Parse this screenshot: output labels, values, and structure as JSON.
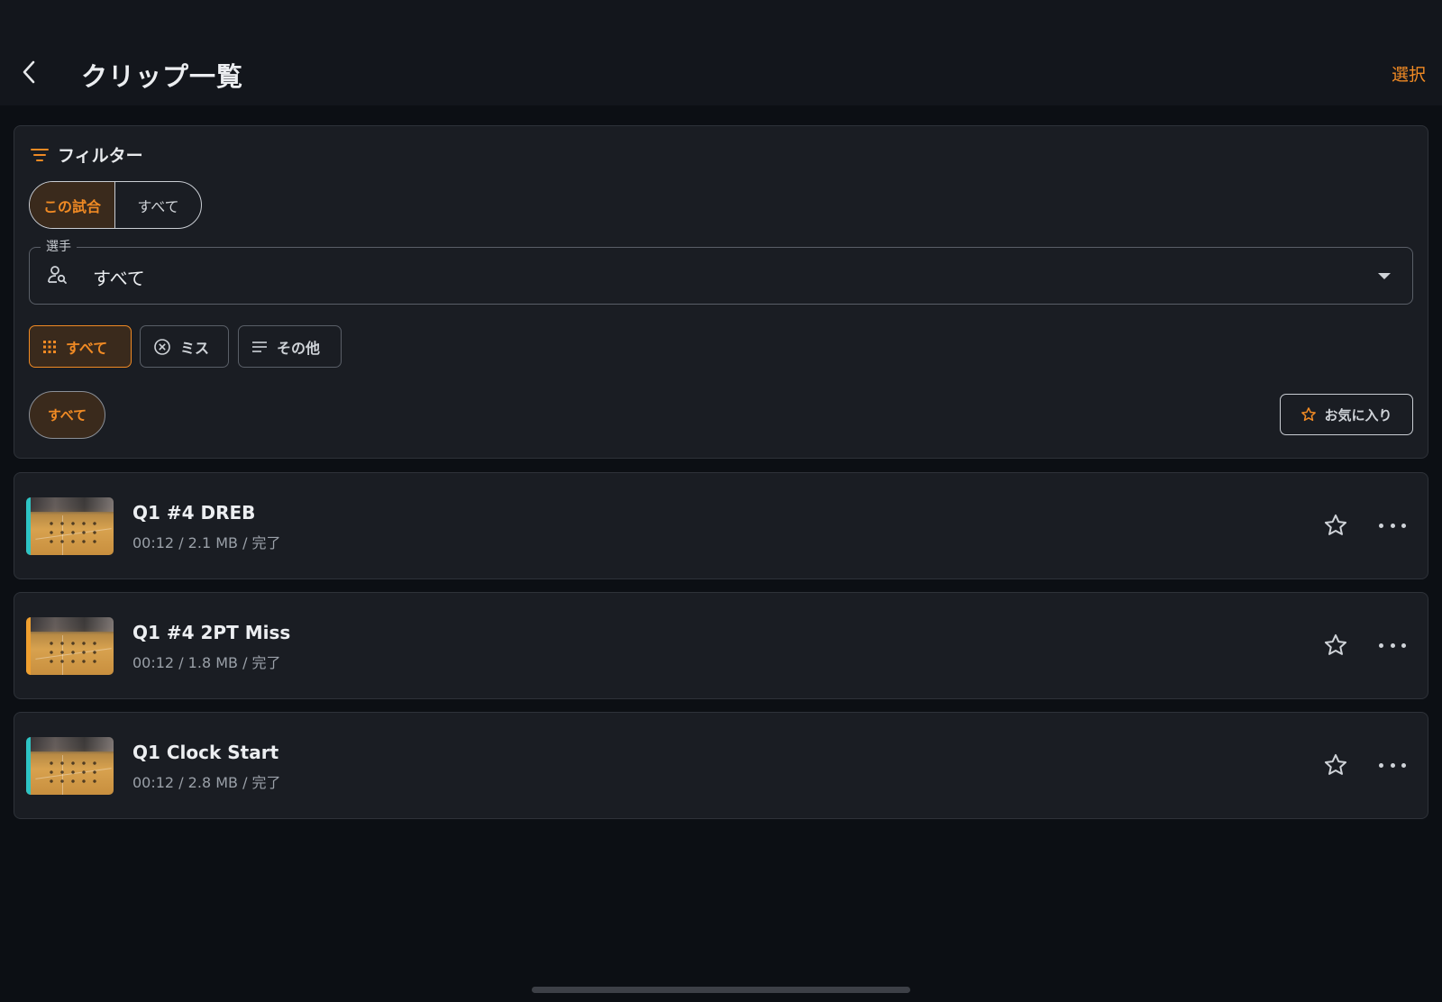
{
  "header": {
    "title": "クリップ一覧",
    "select_label": "選択"
  },
  "filter": {
    "heading": "フィルター",
    "scope": [
      {
        "label": "この試合",
        "active": true
      },
      {
        "label": "すべて",
        "active": false
      }
    ],
    "player_field": {
      "label": "選手",
      "value": "すべて"
    },
    "type_chips": [
      {
        "label": "すべて",
        "icon": "grid-icon",
        "active": true
      },
      {
        "label": "ミス",
        "icon": "x-circle-icon",
        "active": false
      },
      {
        "label": "その他",
        "icon": "lines-icon",
        "active": false
      }
    ],
    "quarter_pill": "すべて",
    "favorites_label": "お気に入り"
  },
  "clips": [
    {
      "title": "Q1 #4 DREB",
      "meta": "00:12 / 2.1 MB / 完了",
      "accent": "#2ec4c4"
    },
    {
      "title": "Q1 #4 2PT Miss",
      "meta": "00:12 / 1.8 MB / 完了",
      "accent": "#f0a030"
    },
    {
      "title": "Q1 Clock Start",
      "meta": "00:12 / 2.8 MB / 完了",
      "accent": "#2ec4c4"
    }
  ],
  "colors": {
    "accent": "#f08a24",
    "background": "#0c0f14",
    "card": "#1a1d23"
  }
}
